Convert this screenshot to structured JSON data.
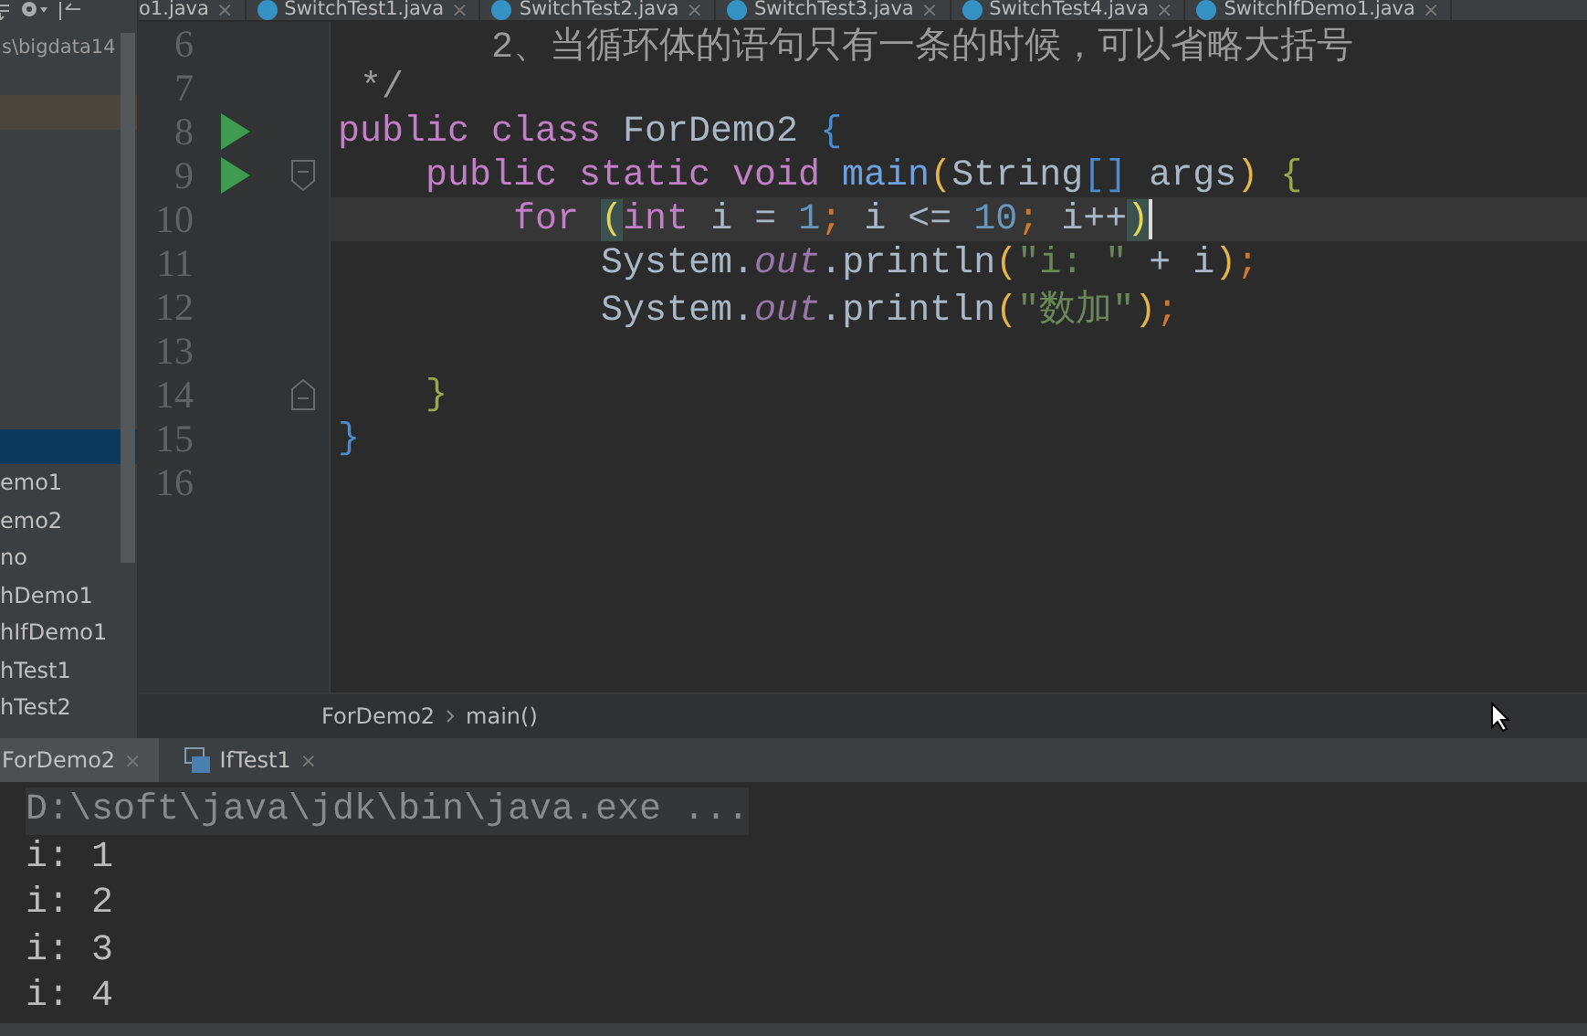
{
  "project_panel": {
    "path": "s\\bigdata14",
    "items": [
      {
        "kind": "marked"
      },
      {
        "kind": "selected"
      },
      {
        "kind": "file",
        "label": "emo1"
      },
      {
        "kind": "file",
        "label": "emo2"
      },
      {
        "kind": "file",
        "label": "no"
      },
      {
        "kind": "file",
        "label": "hDemo1"
      },
      {
        "kind": "file",
        "label": "hIfDemo1"
      },
      {
        "kind": "file",
        "label": "hTest1"
      },
      {
        "kind": "file",
        "label": "hTest2"
      }
    ]
  },
  "editor_tabs": [
    {
      "label": "o1.java",
      "icon": false,
      "close": "×"
    },
    {
      "label": "SwitchTest1.java",
      "icon": true,
      "close": "×"
    },
    {
      "label": "SwitchTest2.java",
      "icon": true,
      "close": "×"
    },
    {
      "label": "SwitchTest3.java",
      "icon": true,
      "close": "×"
    },
    {
      "label": "SwitchTest4.java",
      "icon": true,
      "close": "×"
    },
    {
      "label": "SwitchIfDemo1.java",
      "icon": true,
      "close": "×"
    }
  ],
  "editor": {
    "lines": [
      {
        "number": "6",
        "current": false,
        "run": false,
        "fold_start": false,
        "fold_end": false,
        "tokens": [
          {
            "text": "       2、当循环体的语句只有一条的时候，可以省略大括号",
            "kind": "comment"
          }
        ]
      },
      {
        "number": "7",
        "current": false,
        "run": false,
        "fold_start": false,
        "fold_end": false,
        "tokens": [
          {
            "text": " */",
            "kind": "comment"
          }
        ]
      },
      {
        "number": "8",
        "current": false,
        "run": true,
        "fold_start": false,
        "fold_end": false,
        "tokens": [
          {
            "text": "public class ",
            "kind": "keyword"
          },
          {
            "text": "ForDemo2 ",
            "kind": "plain"
          },
          {
            "text": "{",
            "kind": "brace"
          }
        ]
      },
      {
        "number": "9",
        "current": false,
        "run": true,
        "fold_start": true,
        "fold_end": false,
        "tokens": [
          {
            "text": "    public static void ",
            "kind": "keyword"
          },
          {
            "text": "main",
            "kind": "method"
          },
          {
            "text": "(",
            "kind": "paren"
          },
          {
            "text": "String",
            "kind": "plain"
          },
          {
            "text": "[]",
            "kind": "brace"
          },
          {
            "text": " args",
            "kind": "plain"
          },
          {
            "text": ")",
            "kind": "paren"
          },
          {
            "text": " {",
            "kind": "brace2"
          }
        ]
      },
      {
        "number": "10",
        "current": true,
        "run": false,
        "fold_start": false,
        "fold_end": false,
        "tokens": [
          {
            "text": "        for ",
            "kind": "keyword"
          },
          {
            "text": "(",
            "kind": "matched"
          },
          {
            "text": "int ",
            "kind": "keyword"
          },
          {
            "text": "i = ",
            "kind": "plain"
          },
          {
            "text": "1",
            "kind": "number"
          },
          {
            "text": "; ",
            "kind": "semi"
          },
          {
            "text": "i <= ",
            "kind": "plain"
          },
          {
            "text": "10",
            "kind": "number"
          },
          {
            "text": "; ",
            "kind": "semi"
          },
          {
            "text": "i++",
            "kind": "plain"
          },
          {
            "text": ")",
            "kind": "matched"
          }
        ]
      },
      {
        "number": "11",
        "current": false,
        "run": false,
        "fold_start": false,
        "fold_end": false,
        "tokens": [
          {
            "text": "            System.",
            "kind": "plain"
          },
          {
            "text": "out",
            "kind": "field"
          },
          {
            "text": ".println",
            "kind": "plain"
          },
          {
            "text": "(",
            "kind": "paren"
          },
          {
            "text": "\"i: \"",
            "kind": "string"
          },
          {
            "text": " + i",
            "kind": "plain"
          },
          {
            "text": ")",
            "kind": "paren"
          },
          {
            "text": ";",
            "kind": "semi"
          }
        ]
      },
      {
        "number": "12",
        "current": false,
        "run": false,
        "fold_start": false,
        "fold_end": false,
        "tokens": [
          {
            "text": "            System.",
            "kind": "plain"
          },
          {
            "text": "out",
            "kind": "field"
          },
          {
            "text": ".println",
            "kind": "plain"
          },
          {
            "text": "(",
            "kind": "paren"
          },
          {
            "text": "\"数加\"",
            "kind": "string"
          },
          {
            "text": ")",
            "kind": "paren"
          },
          {
            "text": ";",
            "kind": "semi"
          }
        ]
      },
      {
        "number": "13",
        "current": false,
        "run": false,
        "fold_start": false,
        "fold_end": false
      },
      {
        "number": "14",
        "current": false,
        "run": false,
        "fold_start": false,
        "fold_end": true,
        "tokens": [
          {
            "text": "    }",
            "kind": "brace2"
          }
        ]
      },
      {
        "number": "15",
        "current": false,
        "run": false,
        "fold_start": false,
        "fold_end": false,
        "tokens": [
          {
            "text": "}",
            "kind": "brace"
          }
        ]
      },
      {
        "number": "16",
        "current": false,
        "run": false,
        "fold_start": false,
        "fold_end": false
      }
    ]
  },
  "breadcrumb": [
    "ForDemo2",
    "main()"
  ],
  "run_tabs": [
    {
      "label": "ForDemo2",
      "icon": false,
      "selected": true,
      "close": "×"
    },
    {
      "label": "IfTest1",
      "icon": true,
      "selected": false,
      "close": "×"
    }
  ],
  "console": [
    {
      "text": "D:\\soft\\java\\jdk\\bin\\java.exe ...",
      "kind": "command"
    },
    {
      "text": "i: 1",
      "kind": "output"
    },
    {
      "text": "i: 2",
      "kind": "output"
    },
    {
      "text": "i: 3",
      "kind": "output"
    },
    {
      "text": "i: 4",
      "kind": "output"
    }
  ]
}
